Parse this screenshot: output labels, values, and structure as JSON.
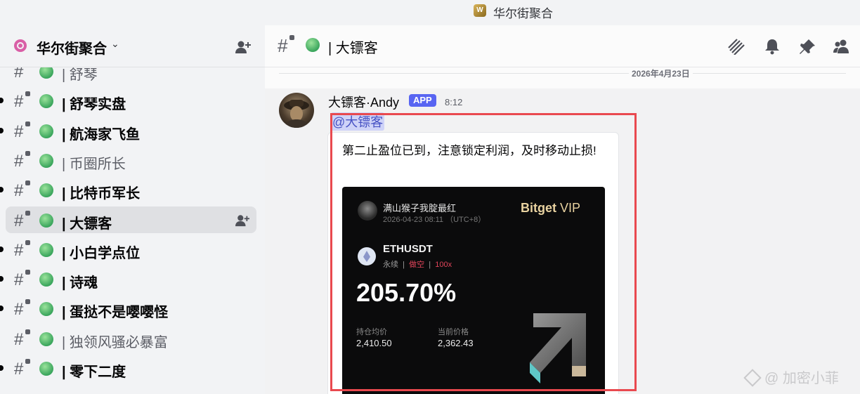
{
  "window": {
    "title": "华尔街聚合"
  },
  "server": {
    "name": "华尔街聚合",
    "chevron": "⌄"
  },
  "sidebar": {
    "channels": [
      {
        "name": "| 舒琴",
        "bold": false,
        "unread": false,
        "active": false
      },
      {
        "name": "| 舒琴实盘",
        "bold": true,
        "unread": true,
        "active": false
      },
      {
        "name": "| 航海家飞鱼",
        "bold": true,
        "unread": true,
        "active": false
      },
      {
        "name": "| 币圈所长",
        "bold": false,
        "unread": false,
        "active": false
      },
      {
        "name": "| 比特币军长",
        "bold": true,
        "unread": true,
        "active": false
      },
      {
        "name": "| 大镖客",
        "bold": true,
        "unread": false,
        "active": true
      },
      {
        "name": "| 小白学点位",
        "bold": true,
        "unread": true,
        "active": false
      },
      {
        "name": "| 诗魂",
        "bold": true,
        "unread": true,
        "active": false
      },
      {
        "name": "| 蛋挞不是嘤嘤怪",
        "bold": true,
        "unread": true,
        "active": false
      },
      {
        "name": "| 独领风骚必暴富",
        "bold": false,
        "unread": false,
        "active": false
      },
      {
        "name": "| 零下二度",
        "bold": true,
        "unread": true,
        "active": false
      }
    ]
  },
  "channel_header": {
    "title": "| 大镖客"
  },
  "chat": {
    "date_divider": "2026年4月23日",
    "message": {
      "author": "大镖客·Andy",
      "badge": "APP",
      "time": "8:12",
      "mention": "@大镖客",
      "text": "第二止盈位已到，注意锁定利润，及时移动止损!"
    }
  },
  "trade_card": {
    "user": "满山猴子我腚最红",
    "datetime": "2026-04-23 08:11 （UTC+8）",
    "brand": "Bitget",
    "brand_suffix": "VIP",
    "pair": "ETHUSDT",
    "contract_type": "永续",
    "direction": "做空",
    "leverage": "100x",
    "separator": "|",
    "pnl_percent": "205.70%",
    "entry_label": "持仓均价",
    "entry_price": "2,410.50",
    "current_label": "当前价格",
    "current_price": "2,362.43"
  },
  "watermark": {
    "text": "@ 加密小菲"
  },
  "colors": {
    "accent": "#5865f2",
    "highlight": "#e9494f",
    "online_dot": "#3aa55c",
    "short": "#e0445a",
    "brand_gold": "#e8d2a0"
  }
}
